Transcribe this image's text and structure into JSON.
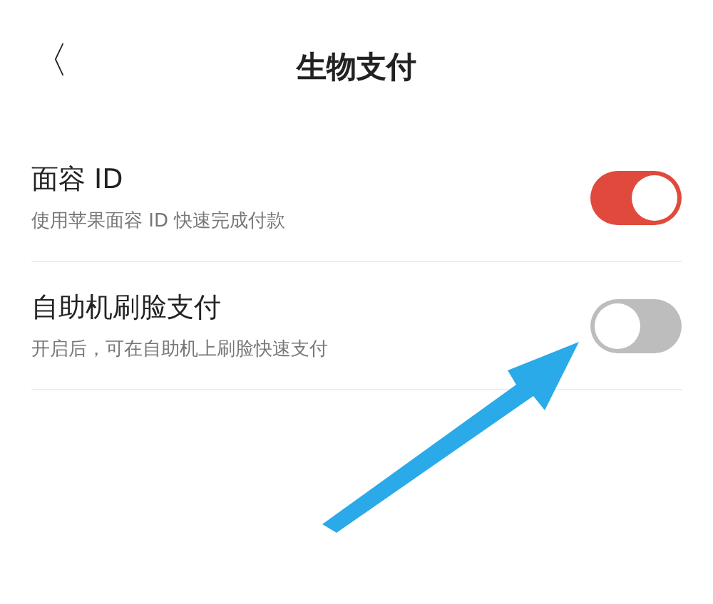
{
  "header": {
    "back": "〈",
    "title": "生物支付"
  },
  "settings": [
    {
      "title": "面容 ID",
      "description": "使用苹果面容 ID 快速完成付款",
      "on": true
    },
    {
      "title": "自助机刷脸支付",
      "description": "开启后，可在自助机上刷脸快速支付",
      "on": false
    }
  ],
  "annotations": [
    {
      "kind": "arrow"
    }
  ]
}
